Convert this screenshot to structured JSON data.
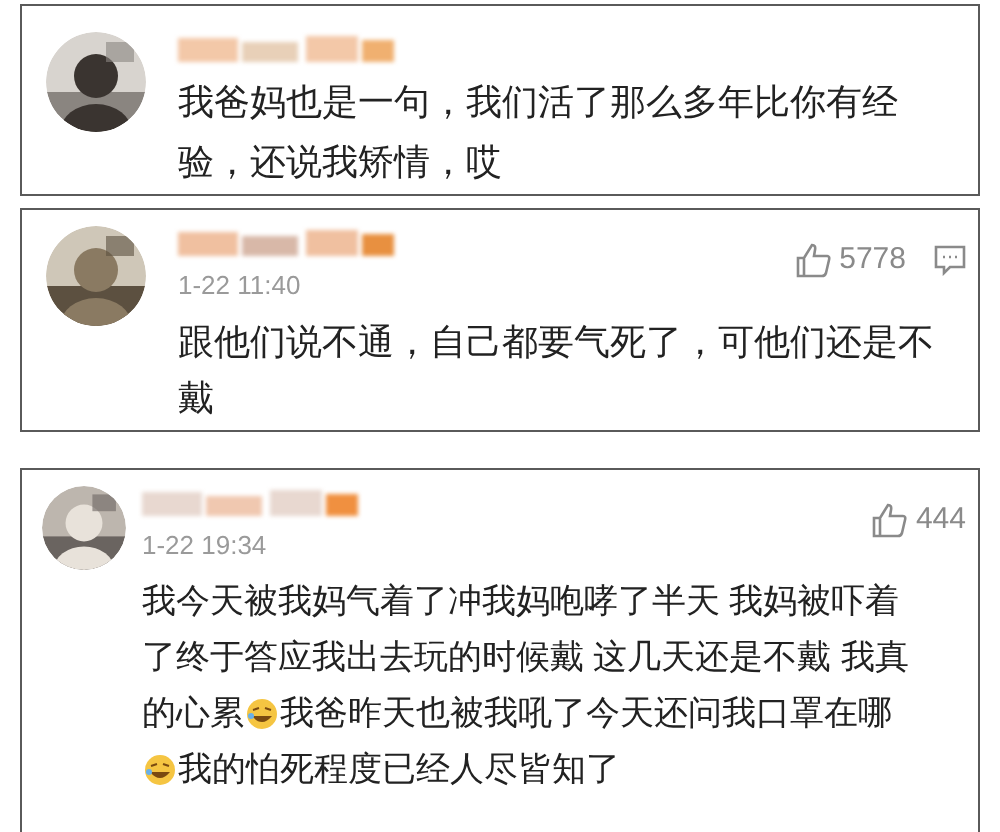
{
  "comments": [
    {
      "avatar": {
        "kind": "picture"
      },
      "reply_icon": false,
      "lines": [
        [
          {
            "kind": "text",
            "text": "我爸妈也是一句，我们活了那么多年比你有经验，还说我矫情，哎"
          }
        ]
      ]
    },
    {
      "avatar": {
        "kind": "picture"
      },
      "time": "1-22 11:40",
      "likes": "5778",
      "reply_icon": true,
      "lines": [
        [
          {
            "kind": "text",
            "text": "跟他们说不通，自己都要气死了，可他们还是不戴"
          }
        ]
      ]
    },
    {
      "avatar": {
        "kind": "picture"
      },
      "time": "1-22 19:34",
      "likes": "444",
      "reply_icon": false,
      "lines": [
        [
          {
            "kind": "text",
            "text": "我今天被我妈气着了冲我妈咆哮了半天 我妈被吓着了终于答应我出去玩的时候戴 这几天还是不戴 我真"
          }
        ],
        [
          {
            "kind": "text",
            "text": "的心累"
          },
          {
            "kind": "emoji"
          },
          {
            "kind": "text",
            "text": "我爸昨天也被我吼了今天还问我口罩在哪"
          }
        ],
        [
          {
            "kind": "emoji"
          },
          {
            "kind": "text",
            "text": "我的怕死程度已经人尽皆知了"
          }
        ]
      ]
    }
  ]
}
